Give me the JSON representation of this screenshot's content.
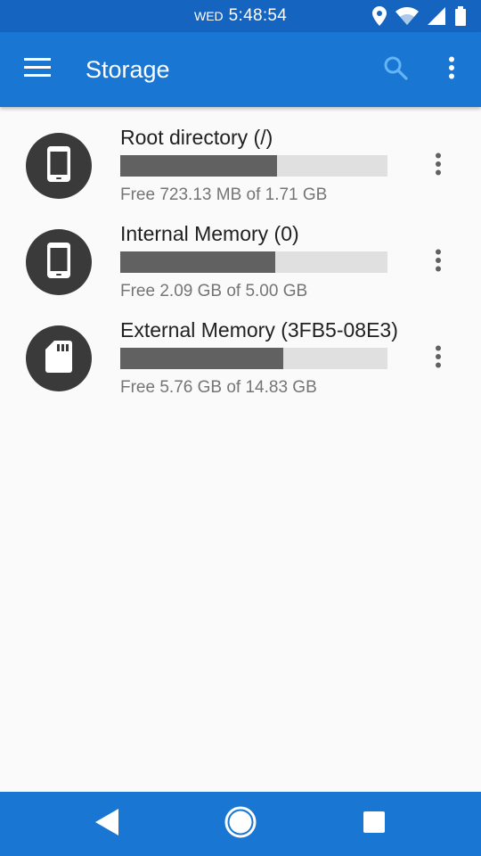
{
  "status_bar": {
    "day": "WED",
    "time": "5:48:54",
    "icons": [
      "location-icon",
      "wifi-icon",
      "signal-icon",
      "battery-icon"
    ]
  },
  "app_bar": {
    "title": "Storage",
    "menu_icon": "hamburger-menu-icon",
    "search_icon": "search-icon",
    "overflow_icon": "more-vert-icon",
    "color": "#1976d2"
  },
  "storage": [
    {
      "name": "Root directory (/)",
      "free_text": "Free 723.13 MB of 1.71 GB",
      "used_fraction": 0.587,
      "icon": "phone-icon"
    },
    {
      "name": "Internal Memory (0)",
      "free_text": "Free 2.09 GB of 5.00 GB",
      "used_fraction": 0.58,
      "icon": "phone-icon"
    },
    {
      "name": "External Memory (3FB5-08E3)",
      "free_text": "Free 5.76 GB of 14.83 GB",
      "used_fraction": 0.61,
      "icon": "sd-card-icon"
    }
  ],
  "nav_bar": {
    "buttons": [
      "back-icon",
      "home-icon",
      "recents-icon"
    ]
  }
}
